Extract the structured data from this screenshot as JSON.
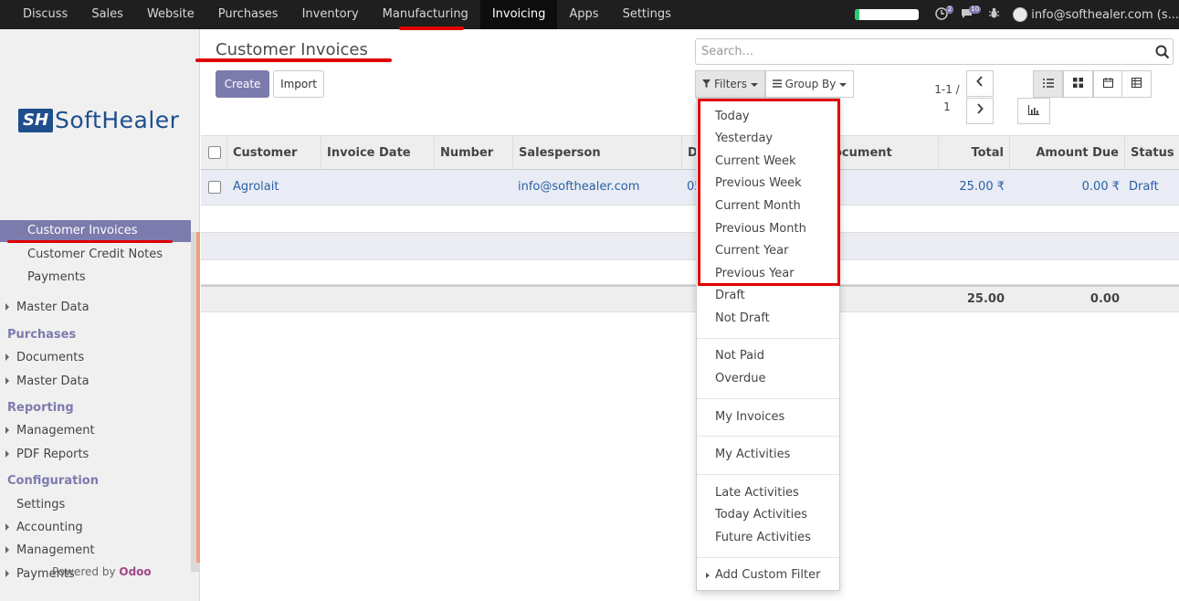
{
  "topbar": {
    "menu": [
      "Discuss",
      "Sales",
      "Website",
      "Purchases",
      "Inventory",
      "Manufacturing",
      "Invoicing",
      "Apps",
      "Settings"
    ],
    "active_index": 6,
    "activity_badge": "2",
    "message_badge": "10",
    "user": "info@softhealer.com (s..."
  },
  "sidebar": {
    "logo_mark": "SH",
    "logo_text": "SoftHealer",
    "items": [
      {
        "label": "Customer Invoices"
      },
      {
        "label": "Customer Credit Notes"
      },
      {
        "label": "Payments"
      },
      {
        "label": "Master Data"
      },
      {
        "label": "Purchases"
      },
      {
        "label": "Documents"
      },
      {
        "label": "Master Data"
      },
      {
        "label": "Reporting"
      },
      {
        "label": "Management"
      },
      {
        "label": "PDF Reports"
      },
      {
        "label": "Configuration"
      },
      {
        "label": "Settings"
      },
      {
        "label": "Accounting"
      },
      {
        "label": "Management"
      },
      {
        "label": "Payments"
      }
    ],
    "powered_prefix": "Powered by",
    "powered_brand": "Odoo"
  },
  "control": {
    "title": "Customer Invoices",
    "create_label": "Create",
    "import_label": "Import",
    "search_placeholder": "Search...",
    "filters_label": "Filters",
    "groupby_label": "Group By",
    "pager_line1": "1-1 /",
    "pager_line2": "1",
    "prev_label": "‹",
    "next_label": "›",
    "views": [
      "list-view-icon",
      "kanban-view-icon",
      "calendar-view-icon",
      "pivot-view-icon",
      "graph-view-icon"
    ]
  },
  "table": {
    "headers": [
      "Customer",
      "Invoice Date",
      "Number",
      "Salesperson",
      "D",
      "ocument",
      "Total",
      "Amount Due",
      "Status"
    ],
    "row": {
      "customer": "Agrolait",
      "invoice_date": "",
      "number": "",
      "salesperson": "info@softhealer.com",
      "due": "05",
      "total": "25.00 ₹",
      "amount_due": "0.00 ₹",
      "status": "Draft"
    },
    "footer": {
      "total": "25.00",
      "amount_due": "0.00"
    }
  },
  "filters_menu": {
    "group1": [
      "Today",
      "Yesterday",
      "Current Week",
      "Previous Week",
      "Current Month",
      "Previous Month",
      "Current Year",
      "Previous Year",
      "Draft",
      "Not Draft"
    ],
    "group2": [
      "Not Paid",
      "Overdue"
    ],
    "group3": [
      "My Invoices"
    ],
    "group4": [
      "My Activities"
    ],
    "group5": [
      "Late Activities",
      "Today Activities",
      "Future Activities"
    ],
    "custom_filter": "Add Custom Filter"
  },
  "colors": {
    "accent": "#7c7bad",
    "link": "#2a5fa3",
    "highlight": "#e00000"
  }
}
